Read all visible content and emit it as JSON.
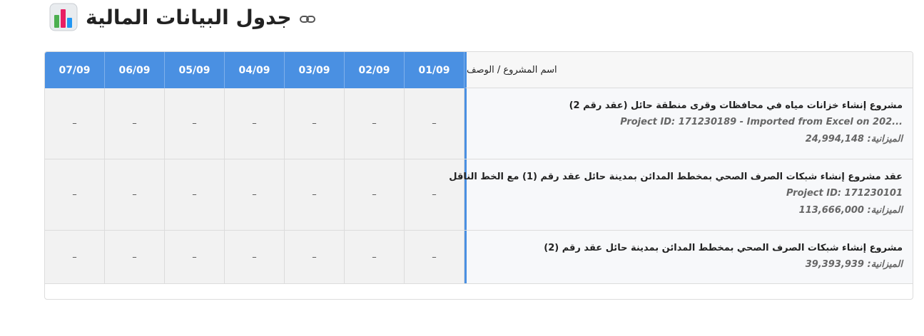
{
  "page": {
    "title": "جدول البيانات المالية",
    "icons": {
      "chart": "bar-chart-icon",
      "link": "link-icon"
    }
  },
  "table": {
    "name_header": "اسم المشروع / الوصف",
    "dates": [
      "01/09",
      "02/09",
      "03/09",
      "04/09",
      "05/09",
      "06/09",
      "07/09"
    ],
    "rows": [
      {
        "name": "مشروع إنشاء خزانات مياه في محافظات وقرى منطقة حائل (عقد رقم 2)",
        "project_id": "Project ID: 171230189 - Imported from Excel on 202...",
        "budget": "الميزانية: 24,994,148",
        "values": [
          "–",
          "–",
          "–",
          "–",
          "–",
          "–",
          "–"
        ]
      },
      {
        "name": "عقد مشروع إنشاء شبكات الصرف الصحي بمخطط المدائن بمدينة حائل عقد رقم (1) مع الخط الناقل",
        "project_id": "Project ID: 171230101",
        "budget": "الميزانية: 113,666,000",
        "values": [
          "–",
          "–",
          "–",
          "–",
          "–",
          "–",
          "–"
        ]
      },
      {
        "name": "مشروع إنشاء شبكات الصرف الصحي بمخطط المدائن بمدينة حائل عقد رقم (2)",
        "budget": "الميزانية: 39,393,939",
        "values": [
          "–",
          "–",
          "–",
          "–",
          "–",
          "–",
          "–"
        ]
      }
    ]
  },
  "colors": {
    "header_blue": "#4a90e2",
    "cell_bg": "#f2f2f2",
    "border": "#dcdcdc"
  }
}
